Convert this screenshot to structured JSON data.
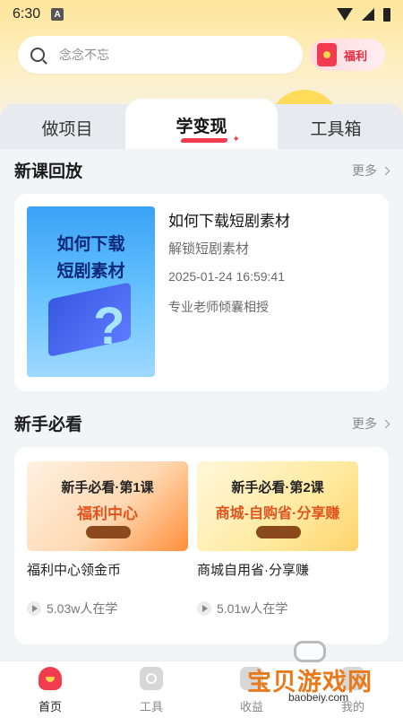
{
  "status_bar": {
    "time": "6:30",
    "notif_letter": "A"
  },
  "search": {
    "placeholder": "念念不忘"
  },
  "fuli_button": {
    "label": "福利"
  },
  "tabs": [
    {
      "label": "做项目",
      "active": false
    },
    {
      "label": "学变现",
      "active": true
    },
    {
      "label": "工具箱",
      "active": false
    }
  ],
  "new_courses": {
    "title": "新课回放",
    "more": "更多",
    "course": {
      "thumb_lines": [
        "如何下载",
        "短剧素材"
      ],
      "title": "如何下载短剧素材",
      "subtitle": "解锁短剧素材",
      "time": "2025-01-24 16:59:41",
      "teacher": "专业老师倾囊相授"
    }
  },
  "beginner": {
    "title": "新手必看",
    "more": "更多",
    "items": [
      {
        "thumb_line1": "新手必看·第1课",
        "thumb_line2": "福利中心",
        "title": "福利中心领金币",
        "learners": "5.03w人在学"
      },
      {
        "thumb_line1": "新手必看·第2课",
        "thumb_line2": "商城-自购省·分享赚",
        "title": "商城自用省·分享赚",
        "learners": "5.01w人在学"
      }
    ]
  },
  "bottom_nav": [
    {
      "label": "首页",
      "active": true
    },
    {
      "label": "工具",
      "active": false
    },
    {
      "label": "收益",
      "active": false
    },
    {
      "label": "我的",
      "active": false
    }
  ],
  "watermark": {
    "text": "宝贝游戏网",
    "url": "baobeiy.com"
  },
  "colors": {
    "accent": "#f23b4e",
    "banner": "#fde59a",
    "background": "#f3f4f8"
  }
}
